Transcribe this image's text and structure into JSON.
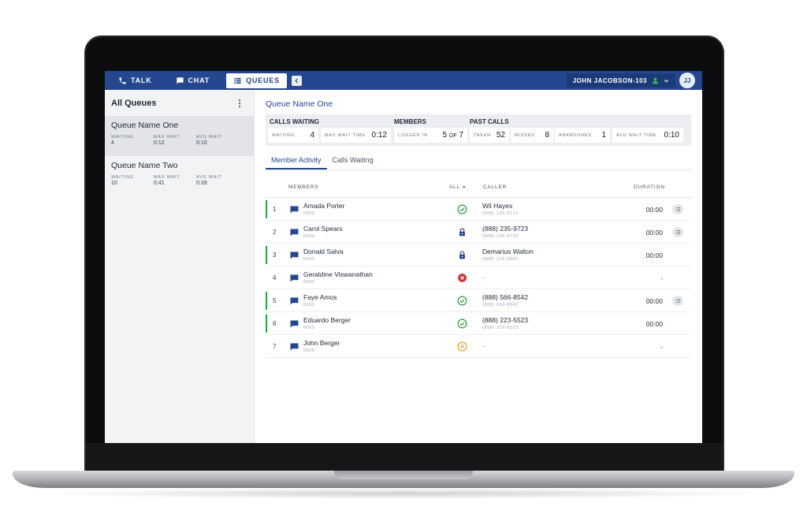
{
  "nav": {
    "tabs": [
      {
        "label": "TALK",
        "icon": "phone-icon"
      },
      {
        "label": "CHAT",
        "icon": "chat-icon"
      },
      {
        "label": "QUEUES",
        "icon": "list-icon"
      }
    ],
    "active_tab": "QUEUES",
    "user_label": "JOHN JACOBSON-103",
    "avatar_initials": "JJ",
    "status_color": "#2ecc40"
  },
  "colors": {
    "primary": "#24478f",
    "active_green": "#22a83a",
    "ok_green": "#2e9e3f",
    "declined_red": "#d32f2f",
    "paused_amber": "#e0a321"
  },
  "sidebar": {
    "title": "All Queues",
    "queues": [
      {
        "name": "Queue Name One",
        "waiting_label": "WAITING",
        "waiting": "4",
        "max_wait_label": "MAX WAIT",
        "max_wait": "0:12",
        "avg_wait_label": "AVG WAIT",
        "avg_wait": "0:10"
      },
      {
        "name": "Queue Name Two",
        "waiting_label": "WAITING",
        "waiting": "10",
        "max_wait_label": "MAX WAIT",
        "max_wait": "0:41",
        "avg_wait_label": "AVG WAIT",
        "avg_wait": "0:39"
      }
    ]
  },
  "main": {
    "title": "Queue Name One",
    "summary": {
      "calls_waiting_heading": "CALLS WAITING",
      "members_heading": "MEMBERS",
      "past_calls_heading": "PAST CALLS",
      "waiting_label": "WAITING",
      "waiting": "4",
      "max_wait_label": "MAX WAIT TIME",
      "max_wait": "0:12",
      "logged_in_label": "LOGGED IN",
      "logged_in": "5",
      "logged_in_of": "OF",
      "logged_in_total": "7",
      "taken_label": "TAKEN",
      "taken": "52",
      "missed_label": "MISSED",
      "missed": "8",
      "abandoned_label": "ABANDONED",
      "abandoned": "1",
      "avg_wait_label": "AVG WAIT TIME",
      "avg_wait": "0:10"
    },
    "tabs": [
      "Member Activity",
      "Calls Waiting"
    ],
    "table": {
      "headers": {
        "members": "MEMBERS",
        "filter": "ALL",
        "caller": "CALLER",
        "duration": "DURATION"
      },
      "rows": [
        {
          "num": "1",
          "name": "Amada Porter",
          "ext": "0000",
          "status": "check",
          "caller": "Wil Hayes",
          "caller_sub": "(888) 135-9121",
          "duration": "00:00",
          "active": true,
          "list": true
        },
        {
          "num": "2",
          "name": "Carol Spears",
          "ext": "0000",
          "status": "lock",
          "caller": "(888) 235-9723",
          "caller_sub": "(888) 235-9723",
          "duration": "00:00",
          "active": false,
          "list": true
        },
        {
          "num": "3",
          "name": "Donald Salva",
          "ext": "0000",
          "status": "lock",
          "caller": "Demarius Walton",
          "caller_sub": "(888) 114-3582",
          "duration": "00:00",
          "active": true,
          "list": false
        },
        {
          "num": "4",
          "name": "Geraldine Viswanathan",
          "ext": "0000",
          "status": "declined",
          "caller": "-",
          "caller_sub": "",
          "duration": "-",
          "active": false,
          "list": false
        },
        {
          "num": "5",
          "name": "Faye Amos",
          "ext": "0000",
          "status": "check",
          "caller": "(888) 566-8542",
          "caller_sub": "(888) 566-8542",
          "duration": "00:00",
          "active": true,
          "list": true
        },
        {
          "num": "6",
          "name": "Eduardo Berger",
          "ext": "0000",
          "status": "check",
          "caller": "(888) 223-5523",
          "caller_sub": "(888) 223-5523",
          "duration": "00:00",
          "active": true,
          "list": false
        },
        {
          "num": "7",
          "name": "John Berger",
          "ext": "0000",
          "status": "paused",
          "caller": "-",
          "caller_sub": "",
          "duration": "-",
          "active": false,
          "list": false
        }
      ]
    }
  }
}
